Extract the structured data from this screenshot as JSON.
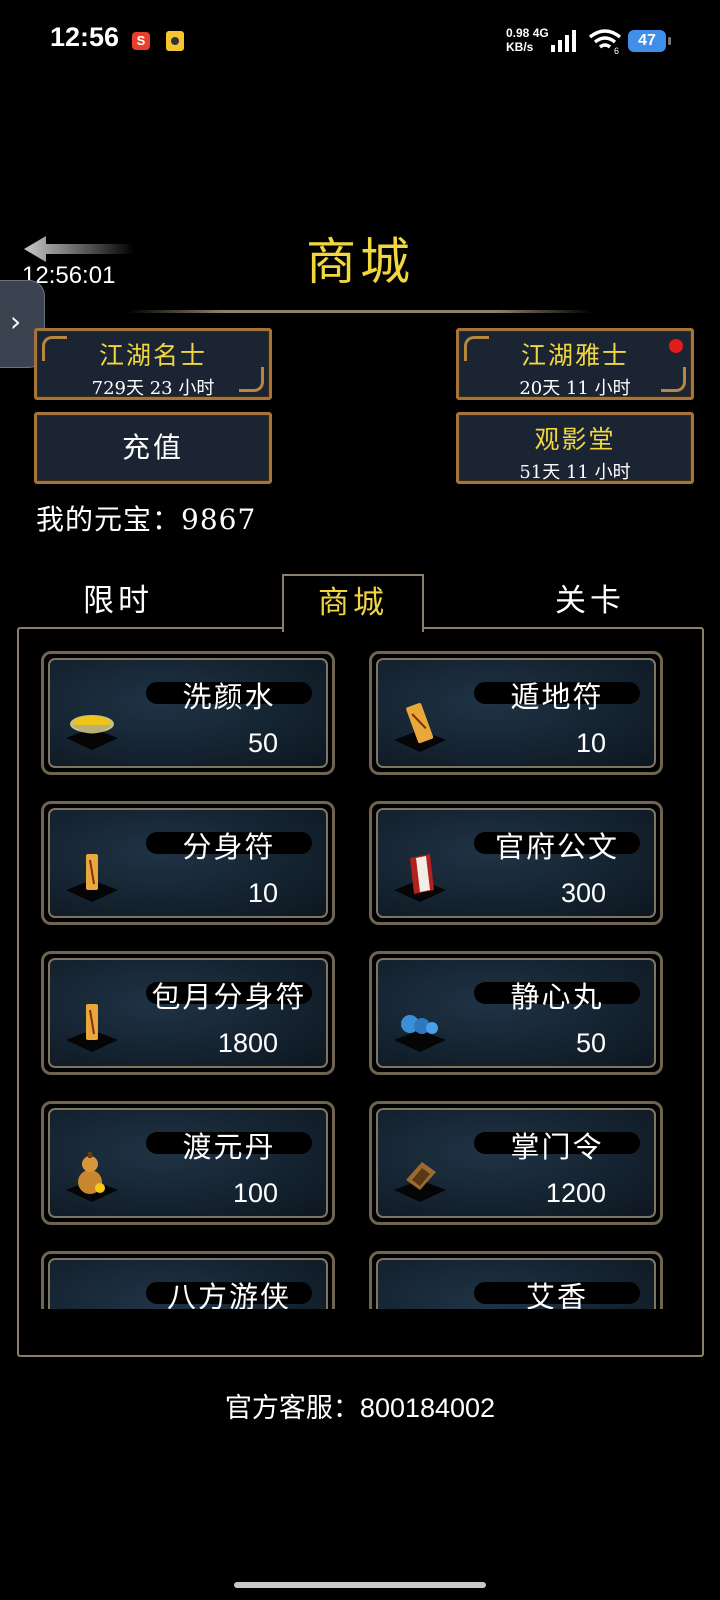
{
  "status_bar": {
    "time": "12:56",
    "notif_1": "S",
    "speed_value": "0.98",
    "speed_unit": "KB/s",
    "network": "4G",
    "wifi_sub": "6",
    "battery": "47"
  },
  "overlay": {
    "time": "12:56:01"
  },
  "header": {
    "title": "商城"
  },
  "top_buttons": {
    "vip1": {
      "title": "江湖名士",
      "sub": "729天 23 小时"
    },
    "vip2": {
      "title": "江湖雅士",
      "sub": "20天 11 小时"
    },
    "recharge": {
      "label": "充值"
    },
    "theater": {
      "title": "观影堂",
      "sub": "51天 11 小时"
    }
  },
  "balance": {
    "label": "我的元宝：",
    "value": "9867"
  },
  "tabs": [
    {
      "label": "限时"
    },
    {
      "label": "商城"
    },
    {
      "label": "关卡"
    }
  ],
  "items": [
    {
      "name": "洗颜水",
      "price": "50",
      "icon": "bowl-icon"
    },
    {
      "name": "遁地符",
      "price": "10",
      "icon": "talisman-icon"
    },
    {
      "name": "分身符",
      "price": "10",
      "icon": "talisman-icon"
    },
    {
      "name": "官府公文",
      "price": "300",
      "icon": "document-icon"
    },
    {
      "name": "包月分身符",
      "price": "1800",
      "icon": "talisman-icon"
    },
    {
      "name": "静心丸",
      "price": "50",
      "icon": "pill-icon"
    },
    {
      "name": "渡元丹",
      "price": "100",
      "icon": "gourd-icon"
    },
    {
      "name": "掌门令",
      "price": "1200",
      "icon": "token-icon"
    },
    {
      "name": "八方游侠",
      "price": "",
      "icon": "hero-icon"
    },
    {
      "name": "艾香",
      "price": "",
      "icon": "incense-icon"
    }
  ],
  "footer": {
    "support_label": "官方客服：",
    "support_number": "800184002"
  },
  "colors": {
    "gold_text": "#f1d63e",
    "frame_border": "#a4743a",
    "panel_border": "#8a7f68",
    "battery": "#3f8ee8"
  }
}
